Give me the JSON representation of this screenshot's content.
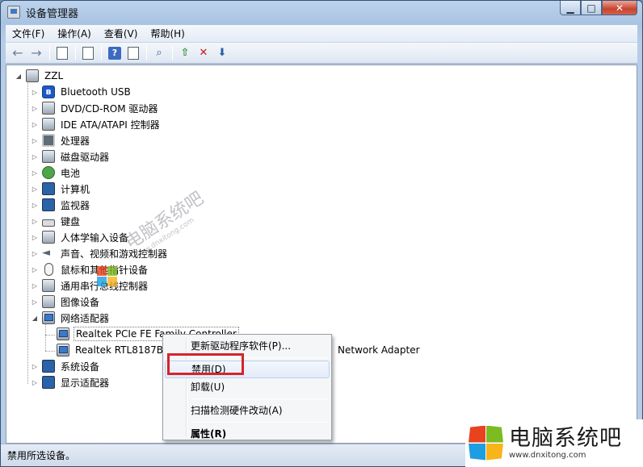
{
  "window": {
    "title": "设备管理器",
    "controls": {
      "minimize": "▁",
      "maximize": "□",
      "close": "✕"
    }
  },
  "menubar": [
    {
      "label": "文件(F)"
    },
    {
      "label": "操作(A)"
    },
    {
      "label": "查看(V)"
    },
    {
      "label": "帮助(H)"
    }
  ],
  "toolbar": {
    "back_icon": "←",
    "forward_icon": "→",
    "help_icon": "?"
  },
  "tree": {
    "root": "ZZL",
    "categories": [
      {
        "label": "Bluetooth USB",
        "icon": "bluetooth-icon"
      },
      {
        "label": "DVD/CD-ROM 驱动器",
        "icon": "disc-drive-icon"
      },
      {
        "label": "IDE ATA/ATAPI 控制器",
        "icon": "ide-controller-icon"
      },
      {
        "label": "处理器",
        "icon": "processor-icon"
      },
      {
        "label": "磁盘驱动器",
        "icon": "disk-drive-icon"
      },
      {
        "label": "电池",
        "icon": "battery-icon"
      },
      {
        "label": "计算机",
        "icon": "computer-icon"
      },
      {
        "label": "监视器",
        "icon": "monitor-icon"
      },
      {
        "label": "键盘",
        "icon": "keyboard-icon"
      },
      {
        "label": "人体学输入设备",
        "icon": "hid-icon"
      },
      {
        "label": "声音、视频和游戏控制器",
        "icon": "audio-icon"
      },
      {
        "label": "鼠标和其他指针设备",
        "icon": "mouse-icon"
      },
      {
        "label": "通用串行总线控制器",
        "icon": "usb-icon"
      },
      {
        "label": "图像设备",
        "icon": "imaging-icon"
      },
      {
        "label": "网络适配器",
        "icon": "network-adapter-icon",
        "expanded": true
      },
      {
        "label": "系统设备",
        "icon": "system-device-icon"
      },
      {
        "label": "显示适配器",
        "icon": "display-adapter-icon"
      }
    ],
    "network_children": [
      {
        "label": "Realtek PCIe FE Family Controller",
        "selected": true
      },
      {
        "label_start": "Realtek RTL8187B ",
        "label_end": "Network Adapter"
      }
    ]
  },
  "context_menu": {
    "items": [
      {
        "label": "更新驱动程序软件(P)..."
      },
      {
        "label": "禁用(D)",
        "hover": true
      },
      {
        "label": "卸载(U)"
      },
      {
        "label": "扫描检测硬件改动(A)"
      },
      {
        "label": "属性(R)",
        "bold": true
      }
    ]
  },
  "statusbar": {
    "text": "禁用所选设备。"
  },
  "watermark": {
    "text": "电脑系统吧",
    "url": "www.dnxitong.com"
  },
  "brand": {
    "name": "电脑系统吧",
    "url": "www.dnxitong.com"
  },
  "colors": {
    "highlight_box": "#d6232b",
    "logo_red": "#e8421f",
    "logo_green": "#7cbb22",
    "logo_blue": "#1e9ee0",
    "logo_yellow": "#f8b41a"
  }
}
